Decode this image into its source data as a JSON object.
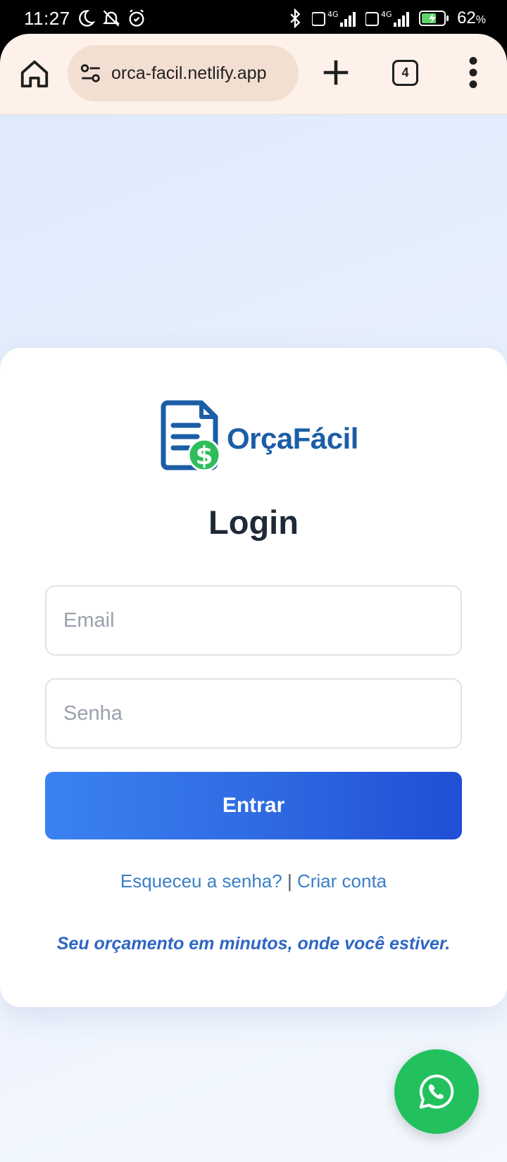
{
  "status_bar": {
    "time": "11:27",
    "battery_value": "62",
    "battery_unit": "%",
    "network_1": "4G",
    "network_2": "4G"
  },
  "browser": {
    "url": "orca-facil.netlify.app",
    "tab_count": "4"
  },
  "logo": {
    "name": "OrçaFácil",
    "icon": "document-dollar-icon",
    "primary_color": "#1b5ea6",
    "accent_color": "#2ebd5a"
  },
  "login": {
    "title": "Login",
    "email_placeholder": "Email",
    "password_placeholder": "Senha",
    "submit_label": "Entrar",
    "forgot_link": "Esqueceu a senha?",
    "separator": "|",
    "create_link": "Criar conta",
    "tagline": "Seu orçamento em minutos, onde você estiver.",
    "button_color": "#2f6be3"
  },
  "whatsapp": {
    "icon": "whatsapp-icon",
    "color": "#22c15e"
  }
}
